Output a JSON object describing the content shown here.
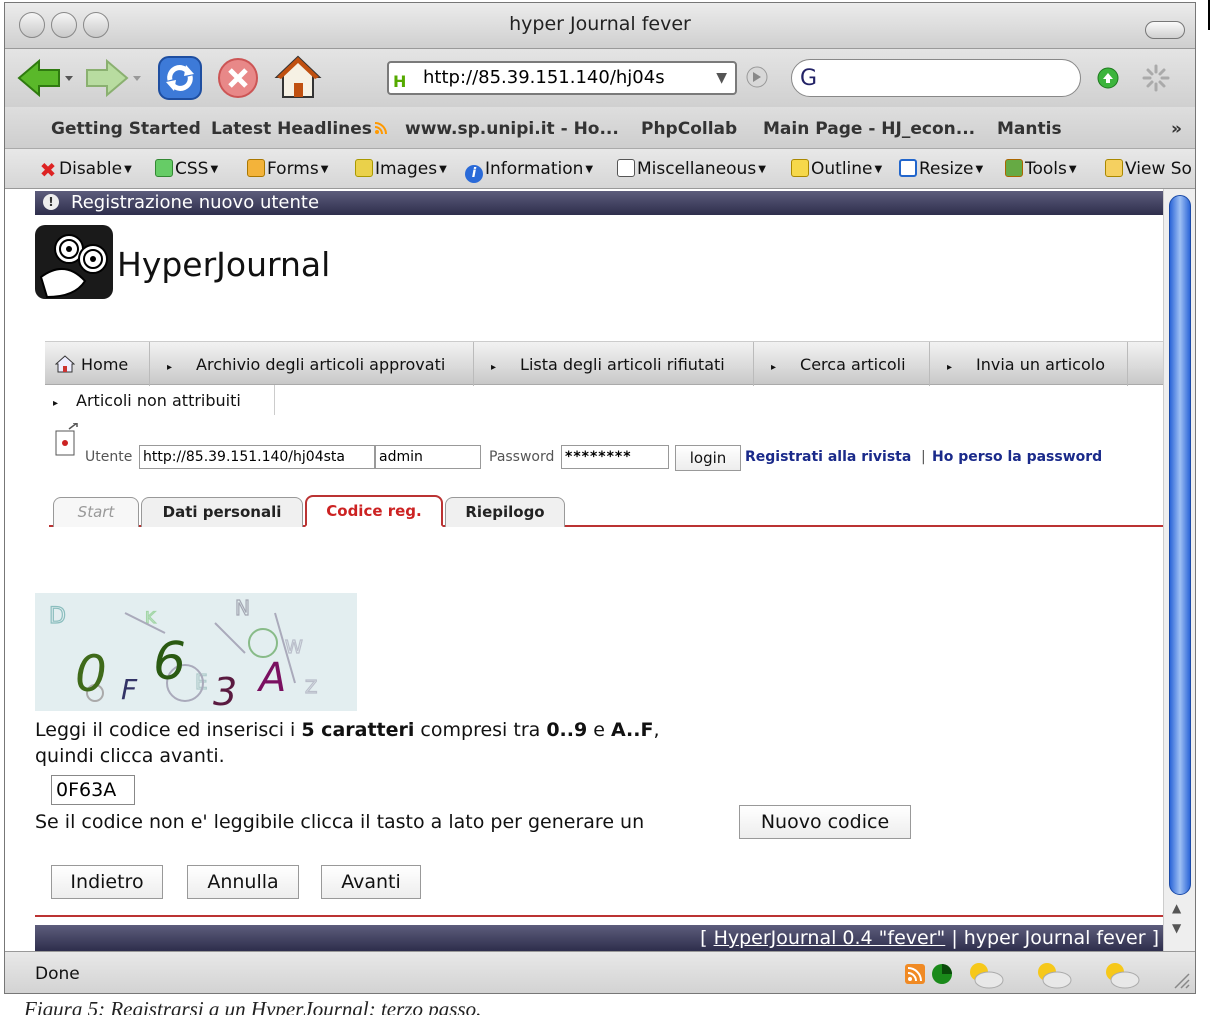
{
  "window": {
    "title": "hyper Journal fever"
  },
  "toolbar": {
    "url": "http://85.39.151.140/hj04s",
    "search_placeholder": ""
  },
  "bookmarks": [
    {
      "label": "Getting Started"
    },
    {
      "label": "Latest Headlines"
    },
    {
      "label": "www.sp.unipi.it - Ho..."
    },
    {
      "label": "PhpCollab"
    },
    {
      "label": "Main Page - HJ_econ..."
    },
    {
      "label": "Mantis"
    },
    {
      "label": "»"
    }
  ],
  "devbar": [
    {
      "label": "Disable",
      "icon": "disable-icon",
      "color": "#d33"
    },
    {
      "label": "CSS",
      "icon": "css-icon",
      "color": "#3a3"
    },
    {
      "label": "Forms",
      "icon": "forms-icon",
      "color": "#e9a010"
    },
    {
      "label": "Images",
      "icon": "images-icon",
      "color": "#c9a020"
    },
    {
      "label": "Information",
      "icon": "information-icon",
      "color": "#2366d8"
    },
    {
      "label": "Miscellaneous",
      "icon": "miscellaneous-icon",
      "color": "#777"
    },
    {
      "label": "Outline",
      "icon": "outline-icon",
      "color": "#e6b400"
    },
    {
      "label": "Resize",
      "icon": "resize-icon",
      "color": "#2266cc"
    },
    {
      "label": "Tools",
      "icon": "tools-icon",
      "color": "#4a8a2a"
    },
    {
      "label": "View So",
      "icon": "view-source-icon",
      "color": "#d8a000"
    }
  ],
  "page": {
    "header": "Registrazione nuovo utente",
    "logo_text": "HyperJournal",
    "menu": [
      {
        "label": "Home"
      },
      {
        "label": "Archivio degli articoli approvati"
      },
      {
        "label": "Lista degli articoli rifiutati"
      },
      {
        "label": "Cerca articoli"
      },
      {
        "label": "Invia un articolo"
      }
    ],
    "menu_second": "Articoli non attribuiti",
    "login": {
      "user_label": "Utente",
      "url_value": "http://85.39.151.140/hj04sta",
      "user_value": "admin",
      "password_label": "Password",
      "password_value": "********",
      "login_button": "login",
      "register_link": "Registrati alla rivista",
      "separator": "|",
      "lost_password_link": "Ho perso la password"
    },
    "tabs": [
      {
        "label": "Start",
        "state": "disabled"
      },
      {
        "label": "Dati personali",
        "state": "normal"
      },
      {
        "label": "Codice reg.",
        "state": "active"
      },
      {
        "label": "Riepilogo",
        "state": "normal"
      }
    ],
    "captcha_text": "0F63A",
    "instructions": {
      "part1": "Leggi il codice ed inserisci i ",
      "bold1": "5 caratteri",
      "part2": " compresi tra ",
      "bold2": "0..9",
      "part3": " e ",
      "bold3": "A..F",
      "part4": ",",
      "line2": "quindi clicca avanti."
    },
    "code_input_value": "0F63A",
    "regen_text": "Se il codice non e' leggibile clicca il tasto a lato per generare un",
    "new_code_button": "Nuovo codice",
    "buttons": {
      "back": "Indietro",
      "cancel": "Annulla",
      "next": "Avanti"
    },
    "footer": {
      "bracket_open": "[",
      "app_link": "HyperJournal 0.4 \"fever\"",
      "separator": "|",
      "journal": "hyper Journal fever",
      "bracket_close": "]"
    }
  },
  "status": {
    "text": "Done"
  },
  "caption": "Figura 5: Registrarsi a un HyperJournal: terzo passo."
}
